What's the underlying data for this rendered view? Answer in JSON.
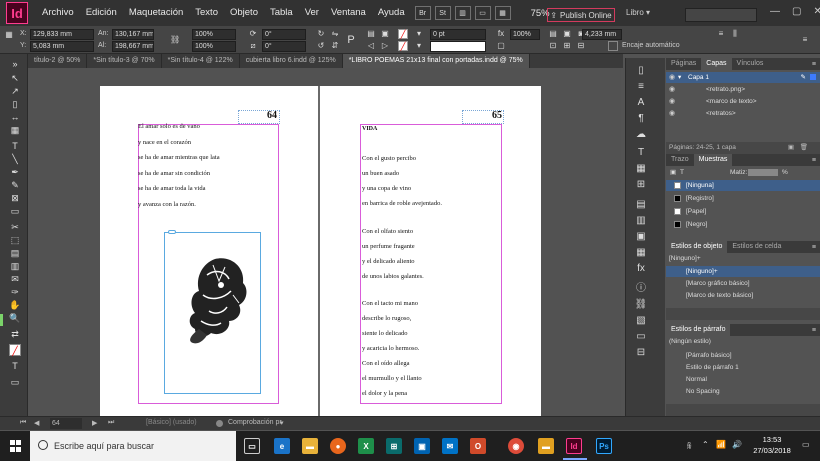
{
  "menubar": {
    "items": [
      "Archivo",
      "Edición",
      "Maquetación",
      "Texto",
      "Objeto",
      "Tabla",
      "Ver",
      "Ventana",
      "Ayuda"
    ],
    "btn_br": "Br",
    "btn_st": "St",
    "zoom": "75%",
    "publish": "Publish Online",
    "workspace": "Libro"
  },
  "control": {
    "x": "129,833 mm",
    "y": "5,083 mm",
    "w": "130,167 mm",
    "h": "198,667 mm",
    "scale_x": "100%",
    "scale_y": "100%",
    "angle": "0°",
    "shear": "0°",
    "stroke": "0 pt",
    "pct": "100%",
    "dim": "4,233 mm",
    "autofit": "Encaje automático"
  },
  "tabs": [
    {
      "label": "título-2 @ 50%",
      "active": false
    },
    {
      "label": "*Sin título-3 @ 70%",
      "active": false
    },
    {
      "label": "*Sin título-4 @ 122%",
      "active": false
    },
    {
      "label": "cubierta libro 6.indd @ 125%",
      "active": false
    },
    {
      "label": "*LIBRO POEMAS 21x13 final con portadas.indd @ 75%",
      "active": true
    }
  ],
  "left_page": {
    "number": "64",
    "lines": [
      "El amar solo es de vano",
      "y nace en el corazón",
      "se ha de amar mientras que lata",
      "se ha de amar sin condición",
      "se ha de amar toda la vida",
      "y avanza con la razón."
    ]
  },
  "right_page": {
    "number": "65",
    "heading": "VIDA",
    "lines": [
      "Con el gusto percibo",
      "un buen asado",
      "y una copa de vino",
      "en barrica de roble avejentado.",
      "Con el olfato siento",
      "un perfume fragante",
      "y el delicado aliento",
      "de unos labios galantes.",
      "Con el tacto mi mano",
      "describe lo rugoso,",
      "siente lo delicado",
      "y acaricia lo hermoso.",
      "Con el oído allega",
      "el murmullo y el llanto",
      "el dolor y la pena"
    ]
  },
  "layers_panel": {
    "tabs": [
      "Páginas",
      "Capas",
      "Vínculos"
    ],
    "items": [
      "Capa 1",
      "<retrato.png>",
      "<marco de texto>",
      "<retratos>"
    ],
    "footer": "Páginas: 24-25, 1 capa"
  },
  "swatches_panel": {
    "tabs": [
      "Trazo",
      "Muestras"
    ],
    "tint_label": "Matiz:",
    "pct_sign": "%",
    "items": [
      {
        "label": "[Ninguna]",
        "color": "#ffffff"
      },
      {
        "label": "[Registro]",
        "color": "#000000"
      },
      {
        "label": "[Papel]",
        "color": "#ffffff"
      },
      {
        "label": "[Negro]",
        "color": "#000000"
      }
    ]
  },
  "object_styles": {
    "tabs": [
      "Estilos de objeto",
      "Estilos de celda"
    ],
    "current": "[Ninguno]+",
    "items": [
      "[Ninguno]+",
      "[Marco gráfico básico]",
      "[Marco de texto básico]"
    ]
  },
  "paragraph_styles": {
    "tabs": [
      "Estilos de párrafo"
    ],
    "current": "(Ningún estilo)",
    "items": [
      "[Párrafo básico]",
      "Estilo de párrafo 1",
      "Normal",
      "No Spacing"
    ]
  },
  "statusbar": {
    "page": "64",
    "style": "[Básico] (usado)",
    "preflight": "Comprobación pr"
  },
  "taskbar": {
    "search_placeholder": "Escribe aquí para buscar",
    "time": "13:53",
    "date": "27/03/2018",
    "app_id": "Id",
    "app_ps": "Ps"
  },
  "colors": {
    "accent_indesign": "#ff3c8f",
    "margin_guide": "#d95cd9",
    "frame_blue": "#5aa9e0"
  }
}
